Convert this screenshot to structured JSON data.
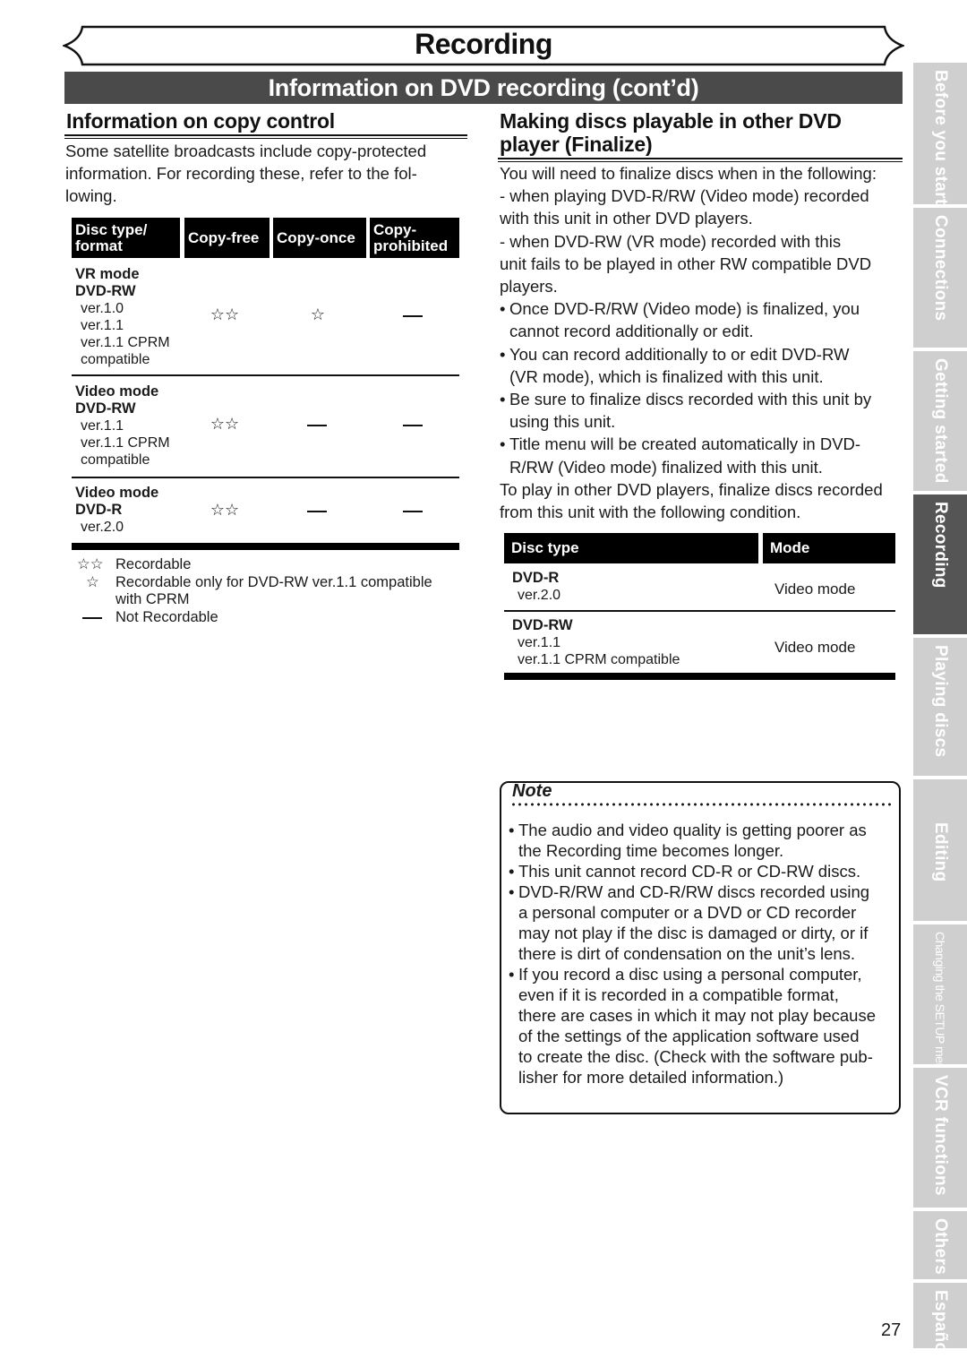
{
  "banner": {
    "title": "Recording"
  },
  "section_bar": {
    "title": "Information on DVD recording (cont’d)"
  },
  "copy_control": {
    "heading": "Information on copy control",
    "intro_lines": [
      "Some satellite broadcasts include copy-protected",
      "information. For recording these, refer to the fol-",
      "lowing."
    ],
    "table": {
      "headers": [
        {
          "line1": "Disc type/",
          "line2": "format"
        },
        {
          "line1": "Copy-free",
          "line2": ""
        },
        {
          "line1": "Copy-once",
          "line2": ""
        },
        {
          "line1": "Copy-",
          "line2": "prohibited"
        }
      ],
      "rows": [
        {
          "mode": "VR mode",
          "disc": "DVD-RW",
          "versions": [
            "ver.1.0",
            "ver.1.1",
            "ver.1.1 CPRM",
            "compatible"
          ],
          "copy_free": "☆☆",
          "copy_once": "☆",
          "copy_prohibited": "—"
        },
        {
          "mode": "Video mode",
          "disc": "DVD-RW",
          "versions": [
            "ver.1.1",
            "ver.1.1 CPRM",
            "compatible"
          ],
          "copy_free": "☆☆",
          "copy_once": "—",
          "copy_prohibited": "—"
        },
        {
          "mode": "Video mode",
          "disc": "DVD-R",
          "versions": [
            "ver.2.0"
          ],
          "copy_free": "☆☆",
          "copy_once": "—",
          "copy_prohibited": "—"
        }
      ]
    },
    "legend": [
      {
        "symbol": "☆☆",
        "lines": [
          "Recordable"
        ]
      },
      {
        "symbol": "☆",
        "lines": [
          "Recordable only for DVD-RW ver.1.1 compatible",
          "with CPRM"
        ]
      },
      {
        "symbol": "—",
        "lines": [
          "Not Recordable"
        ]
      }
    ]
  },
  "finalize": {
    "heading_lines": [
      "Making discs playable in other DVD",
      "player (Finalize)"
    ],
    "intro": "You will need to finalize discs when in the following:",
    "cases": [
      [
        "- when playing DVD-R/RW (Video mode) recorded",
        "with this unit in other DVD players."
      ],
      [
        "- when DVD-RW (VR mode) recorded with this",
        "unit fails to be played in other RW compatible DVD",
        "players."
      ]
    ],
    "bullets": [
      [
        "Once DVD-R/RW (Video mode) is finalized, you",
        "cannot record additionally or edit."
      ],
      [
        "You can record additionally to or edit DVD-RW",
        "(VR mode), which is finalized with this unit."
      ],
      [
        "Be sure to finalize discs recorded with this unit by",
        "using this unit."
      ],
      [
        "Title menu will be created automatically in DVD-",
        "R/RW (Video mode) finalized with this unit."
      ]
    ],
    "outro_lines": [
      "To play in other DVD players, finalize discs recorded",
      "from this unit with the following condition."
    ],
    "table": {
      "headers": [
        "Disc type",
        "Mode"
      ],
      "rows": [
        {
          "disc": "DVD-R",
          "versions": [
            "ver.2.0"
          ],
          "mode": "Video mode"
        },
        {
          "disc": "DVD-RW",
          "versions": [
            "ver.1.1",
            "ver.1.1 CPRM compatible"
          ],
          "mode": "Video mode"
        }
      ]
    }
  },
  "note": {
    "title": "Note",
    "bullets": [
      [
        "The audio and video quality is getting poorer as",
        "the Recording time becomes longer."
      ],
      [
        "This unit cannot record CD-R or CD-RW discs."
      ],
      [
        "DVD-R/RW and CD-R/RW discs recorded using",
        "a personal computer or a DVD or CD recorder",
        "may not play if the disc is damaged or dirty, or if",
        "there is dirt of condensation on the unit’s lens."
      ],
      [
        "If you record a disc using a personal computer,",
        "even if it is recorded in a compatible format,",
        "there are cases in which it may not play because",
        "of the settings of the application software used",
        "to create the disc. (Check with the software pub-",
        "lisher for more detailed information.)"
      ]
    ]
  },
  "side_tabs": [
    {
      "label": "Before you start",
      "active": false
    },
    {
      "label": "Connections",
      "active": false
    },
    {
      "label": "Getting started",
      "active": false
    },
    {
      "label": "Recording",
      "active": true
    },
    {
      "label": "Playing discs",
      "active": false
    },
    {
      "label": "Editing",
      "active": false
    },
    {
      "label": "Changing the SETUP menu",
      "active": false
    },
    {
      "label": "VCR functions",
      "active": false
    },
    {
      "label": "Others",
      "active": false
    },
    {
      "label": "Español",
      "active": false
    }
  ],
  "page_number": "27",
  "colors": {
    "section_bar": "#4a4a4a",
    "tab_inactive": "#cfcfcf",
    "tab_active": "#555555",
    "table_header": "#000000"
  }
}
